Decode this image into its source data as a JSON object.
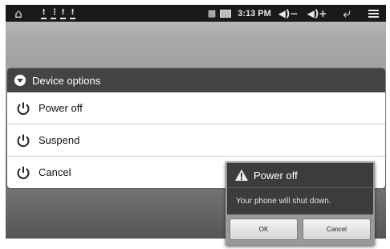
{
  "status_bar": {
    "icons": [
      "home-icon",
      "notification-icon",
      "notification-icon",
      "notification-icon",
      "notification-icon",
      "sim-icon",
      "battery-icon",
      "volume-down-icon",
      "volume-up-icon",
      "back-icon",
      "menu-icon"
    ],
    "time": "3:13 PM",
    "vol_down": "◀)−",
    "vol_up": "◀)+"
  },
  "device_options": {
    "title": "Device options",
    "items": [
      {
        "label": "Power off",
        "icon": "power-icon"
      },
      {
        "label": "Suspend",
        "icon": "power-icon"
      },
      {
        "label": "Cancel",
        "icon": "power-icon"
      }
    ]
  },
  "confirm_dialog": {
    "title": "Power off",
    "message": "Your phone will shut down.",
    "ok_label": "OK",
    "cancel_label": "Cancel",
    "icon": "warning-icon"
  },
  "colors": {
    "status_bar_bg": "#1a1a1a",
    "dialog_title_bg": "#444444",
    "popup_bg": "#3c3c3c"
  }
}
